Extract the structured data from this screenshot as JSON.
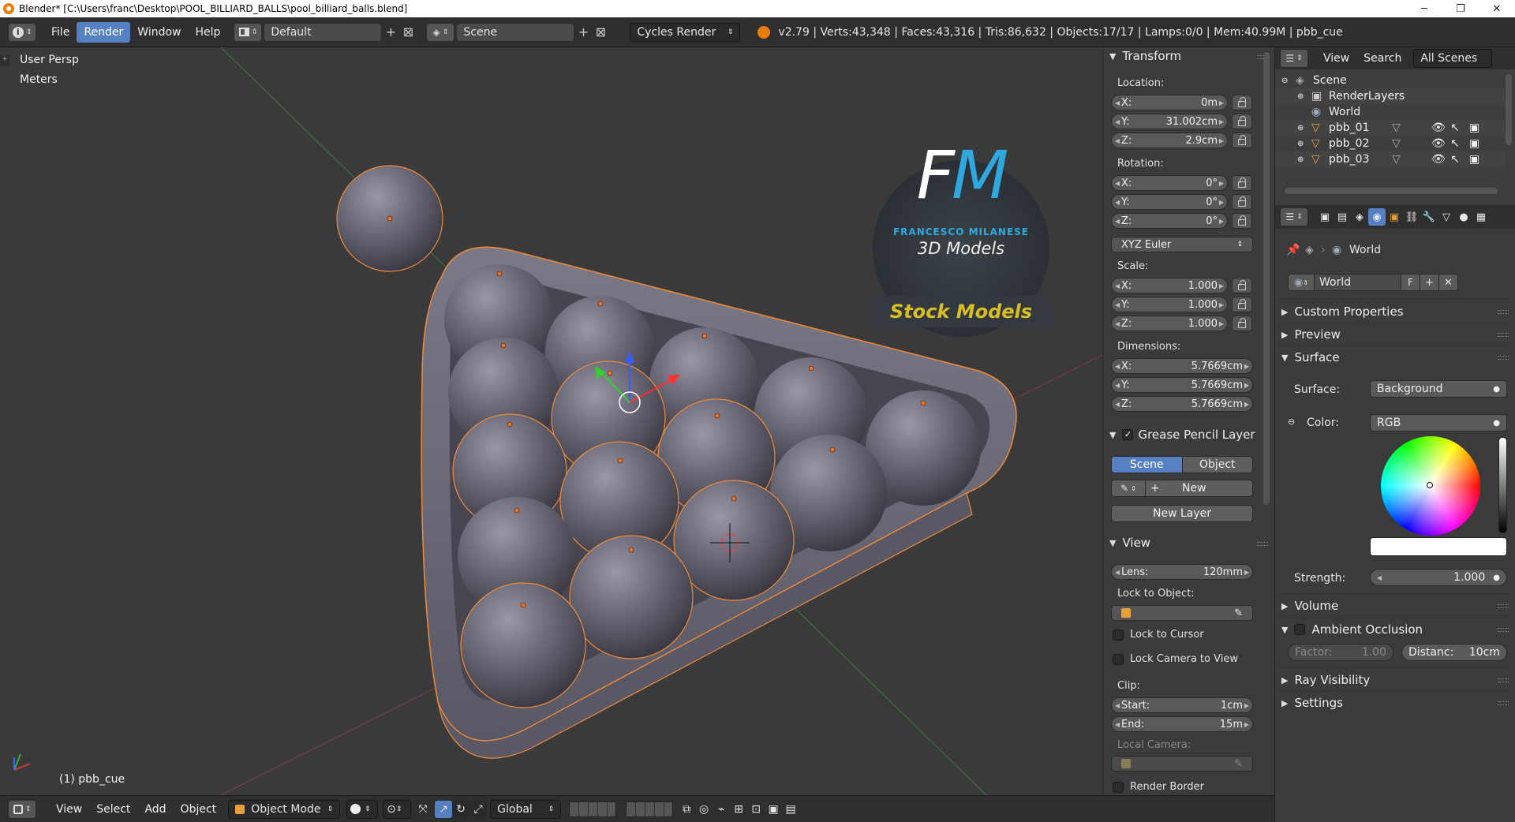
{
  "window": {
    "title": "Blender* [C:\\Users\\franc\\Desktop\\POOL_BILLIARD_BALLS\\pool_billiard_balls.blend]",
    "min": "─",
    "max": "❐",
    "close": "✕"
  },
  "info_header": {
    "menus": [
      "File",
      "Render",
      "Window",
      "Help"
    ],
    "active_menu": "Render",
    "screen_layout": "Default",
    "scene": "Scene",
    "render_engine": "Cycles Render",
    "stats": "v2.79 | Verts:43,348 | Faces:43,316 | Tris:86,632 | Objects:17/17 | Lamps:0/0 | Mem:40.99M | pbb_cue"
  },
  "viewport": {
    "view_name": "User Persp",
    "units": "Meters",
    "active_object": "(1) pbb_cue",
    "logo": {
      "letters": "FM",
      "line1": "FRANCESCO MILANESE",
      "line2": "3D Models",
      "banner": "Stock Models"
    }
  },
  "viewport_header": {
    "menus": [
      "View",
      "Select",
      "Add",
      "Object"
    ],
    "mode": "Object Mode",
    "orientation": "Global"
  },
  "npanel": {
    "transform": {
      "title": "Transform",
      "location_label": "Location:",
      "location": [
        {
          "k": "X:",
          "v": "0m"
        },
        {
          "k": "Y:",
          "v": "31.002cm"
        },
        {
          "k": "Z:",
          "v": "2.9cm"
        }
      ],
      "rotation_label": "Rotation:",
      "rotation": [
        {
          "k": "X:",
          "v": "0°"
        },
        {
          "k": "Y:",
          "v": "0°"
        },
        {
          "k": "Z:",
          "v": "0°"
        }
      ],
      "rotation_mode": "XYZ Euler",
      "scale_label": "Scale:",
      "scale": [
        {
          "k": "X:",
          "v": "1.000"
        },
        {
          "k": "Y:",
          "v": "1.000"
        },
        {
          "k": "Z:",
          "v": "1.000"
        }
      ],
      "dimensions_label": "Dimensions:",
      "dimensions": [
        {
          "k": "X:",
          "v": "5.7669cm"
        },
        {
          "k": "Y:",
          "v": "5.7669cm"
        },
        {
          "k": "Z:",
          "v": "5.7669cm"
        }
      ]
    },
    "grease_pencil": {
      "title": "Grease Pencil Layer",
      "tab_scene": "Scene",
      "tab_object": "Object",
      "new": "New",
      "new_layer": "New Layer"
    },
    "view": {
      "title": "View",
      "lens_label": "Lens:",
      "lens_value": "120mm",
      "lock_to_object": "Lock to Object:",
      "lock_to_cursor": "Lock to Cursor",
      "lock_camera": "Lock Camera to View",
      "clip_label": "Clip:",
      "clip_start_label": "Start:",
      "clip_start": "1cm",
      "clip_end_label": "End:",
      "clip_end": "15m",
      "local_camera": "Local Camera:",
      "render_border": "Render Border"
    }
  },
  "outliner": {
    "menus": [
      "View",
      "Search"
    ],
    "filter": "All Scenes",
    "rows": [
      {
        "label": "Scene"
      },
      {
        "label": "RenderLayers"
      },
      {
        "label": "World"
      },
      {
        "label": "pbb_01"
      },
      {
        "label": "pbb_02"
      },
      {
        "label": "pbb_03"
      }
    ]
  },
  "properties": {
    "breadcrumb": "World",
    "world_name": "World",
    "fake_user": "F",
    "panels": {
      "custom_properties": "Custom Properties",
      "preview": "Preview",
      "surface": "Surface",
      "volume": "Volume",
      "ambient_occlusion": "Ambient Occlusion",
      "ray_visibility": "Ray Visibility",
      "settings": "Settings"
    },
    "surface_label": "Surface:",
    "surface_value": "Background",
    "color_label": "Color:",
    "color_value": "RGB",
    "strength_label": "Strength:",
    "strength_value": "1.000",
    "factor_label": "Factor:",
    "factor_value": "1.00",
    "distance_label": "Distanc:",
    "distance_value": "10cm"
  },
  "colors": {
    "accent": "#5680c2",
    "selection_outline": "#f08a3a",
    "logo_banner_text": "#d9c021",
    "logo_blue": "#2fa8e0"
  }
}
